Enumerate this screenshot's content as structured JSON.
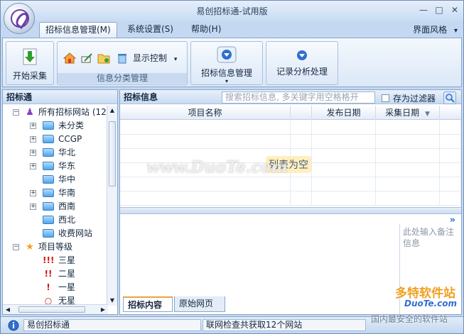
{
  "window": {
    "title": "易创招标通-试用版",
    "minimize": "—",
    "restore": "□",
    "close": "✕"
  },
  "menu": {
    "tabs": [
      "招标信息管理(M)",
      "系统设置(S)",
      "帮助(H)"
    ],
    "skin_label": "界面风格",
    "skin_arrow": "▾"
  },
  "ribbon": {
    "start_collect": "开始采集",
    "display_control": "显示控制",
    "category_group_label": "信息分类管理",
    "bid_info_manage": "招标信息管理",
    "record_analysis": "记录分析处理"
  },
  "left_panel": {
    "title": "招标通",
    "tree": [
      {
        "label": "所有招标网站 (12)",
        "type": "root"
      },
      {
        "label": "未分类",
        "type": "folder",
        "expandable": true
      },
      {
        "label": "CCGP",
        "type": "folder",
        "expandable": true
      },
      {
        "label": "华北",
        "type": "folder",
        "expandable": true
      },
      {
        "label": "华东",
        "type": "folder",
        "expandable": true
      },
      {
        "label": "华中",
        "type": "folder",
        "expandable": false
      },
      {
        "label": "华南",
        "type": "folder",
        "expandable": true
      },
      {
        "label": "西南",
        "type": "folder",
        "expandable": true
      },
      {
        "label": "西北",
        "type": "folder",
        "expandable": false
      },
      {
        "label": "收费网站",
        "type": "folder",
        "expandable": false
      },
      {
        "label": "项目等级",
        "type": "star-root"
      },
      {
        "label": "三星",
        "type": "priority",
        "marks": "!!!"
      },
      {
        "label": "二星",
        "type": "priority",
        "marks": "!!"
      },
      {
        "label": "一星",
        "type": "priority",
        "marks": "!"
      },
      {
        "label": "无星",
        "type": "priority",
        "marks": "○"
      }
    ]
  },
  "right_panel": {
    "title": "招标信息",
    "search_placeholder": "搜索招标信息, 多关键字用空格格开",
    "save_filter": "存为过滤器",
    "columns": [
      "项目名称",
      "发布日期",
      "采集日期"
    ],
    "sort_indicator": "▼",
    "empty_text": "列表为空",
    "expand_arrow": "»",
    "note_placeholder": "此处输入备注信息",
    "bottom_tabs": [
      "招标内容",
      "原始网页"
    ]
  },
  "statusbar": {
    "app_name": "易创招标通",
    "message": "联网检查共获取12个网站"
  },
  "watermarks": {
    "center": "www.DuoTe.com",
    "brand": "多特软件站",
    "brand_url": "DuoTe.com",
    "slogan": "国内最安全的软件站"
  }
}
